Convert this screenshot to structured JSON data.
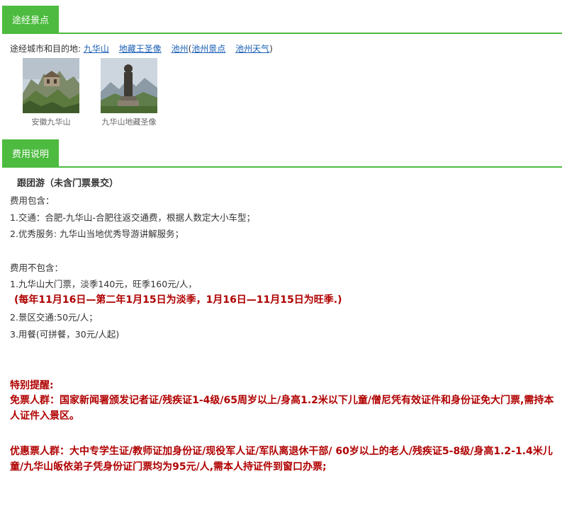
{
  "route_section": {
    "tab_label": "途经景点",
    "route_prefix": "途经城市和目的地:",
    "links": [
      "九华山",
      "地藏王圣像",
      "池州"
    ],
    "paren_open": "(",
    "sublinks": [
      "池州景点",
      "池州天气"
    ],
    "paren_close": ")",
    "thumbnails": [
      {
        "caption": "安徽九华山",
        "icon": "mountain-temple-photo"
      },
      {
        "caption": "九华山地藏圣像",
        "icon": "statue-photo"
      }
    ]
  },
  "fee_section": {
    "tab_label": "费用说明",
    "package_title": "跟团游（未含门票景交）",
    "included_heading": "费用包含：",
    "included_items": [
      "1.交通：合肥-九华山-合肥往返交通费，根据人数定大小车型；",
      "2.优秀服务: 九华山当地优秀导游讲解服务；"
    ],
    "excluded_heading": "费用不包含：",
    "excluded_items": [
      "1.九华山大门票，淡季140元，旺季160元/人，",
      "2.景区交通:50元/人；",
      "3.用餐(可拼餐，30元/人起)"
    ],
    "season_note": "(每年11月16日—第二年1月15日为淡季，1月16日—11月15日为旺季.)",
    "reminder_heading": "特别提醒:",
    "free_ticket_text": "免票人群：国家新闻署颁发记者证/残疾证1-4级/65周岁以上/身高1.2米以下儿童/僧尼凭有效证件和身份证免大门票,需持本人证件入景区。",
    "discount_ticket_text": "优惠票人群：大中专学生证/教师证加身份证/现役军人证/军队离退休干部/ 60岁以上的老人/残疾证5-8级/身高1.2-1.4米儿童/九华山皈依弟子凭身份证门票均为95元/人,需本人持证件到窗口办票;"
  },
  "colors": {
    "accent_green": "#4cbb3f",
    "link_blue": "#1a5fb4",
    "alert_red": "#b00000"
  }
}
